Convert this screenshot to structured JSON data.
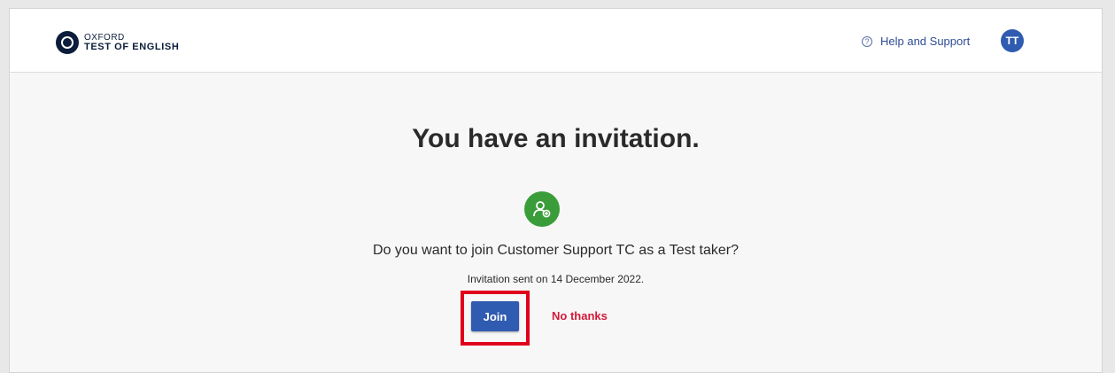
{
  "header": {
    "logo_line1": "OXFORD",
    "logo_line2": "TEST OF ENGLISH",
    "help_label": "Help and Support",
    "avatar_initials": "TT"
  },
  "main": {
    "title": "You have an invitation.",
    "question": "Do you want to join Customer Support TC as a Test taker?",
    "sent_text": "Invitation sent on 14 December 2022.",
    "join_label": "Join",
    "decline_label": "No thanks"
  },
  "colors": {
    "primary": "#2f5bb0",
    "success": "#3a9d3a",
    "danger": "#d11a3a",
    "highlight": "#e0001b"
  },
  "icons": {
    "logo": "oxford-logo-icon",
    "help": "question-circle-icon",
    "invite": "user-add-icon"
  }
}
